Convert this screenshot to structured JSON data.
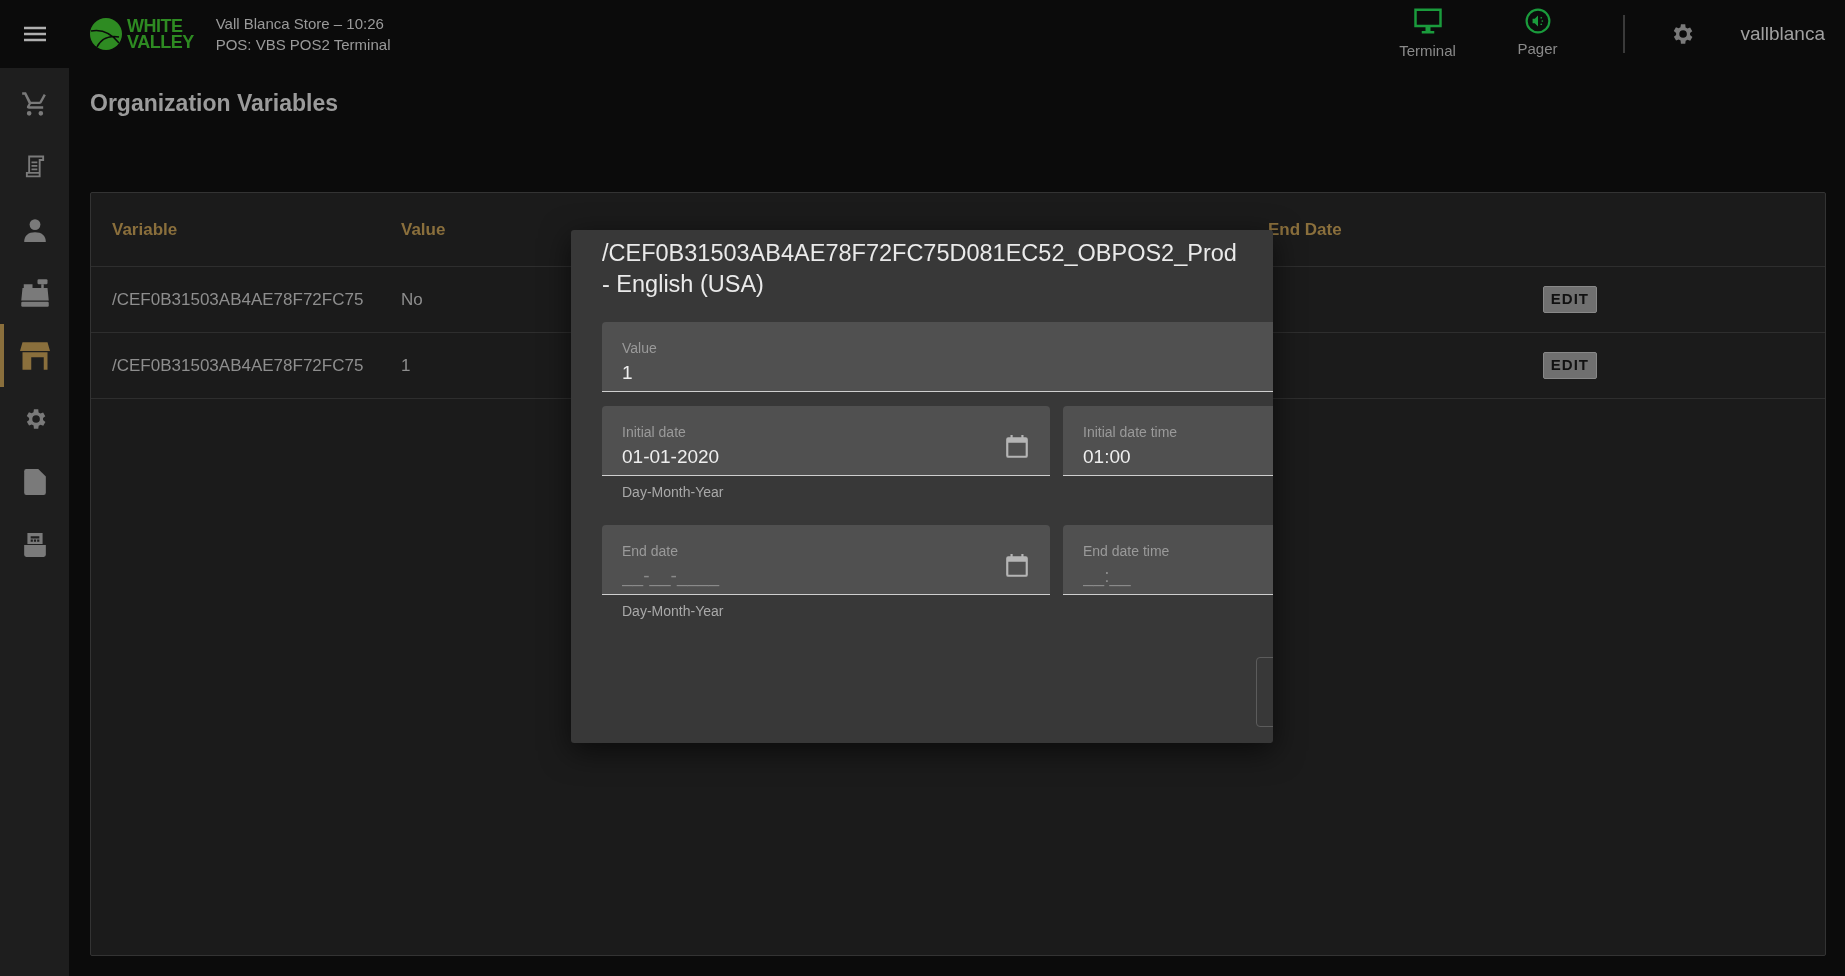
{
  "header": {
    "logo_lines": [
      "WHITE",
      "VALLEY"
    ],
    "store_line": "Vall Blanca Store – 10:26",
    "pos_line": "POS: VBS POS2 Terminal",
    "actions": [
      {
        "kind": "terminal",
        "label": "Terminal"
      },
      {
        "kind": "pager",
        "label": "Pager"
      }
    ],
    "user": "vallblanca"
  },
  "sidebar": {
    "items": [
      {
        "kind": "cart",
        "selected": false
      },
      {
        "kind": "receipt",
        "selected": false
      },
      {
        "kind": "person",
        "selected": false
      },
      {
        "kind": "register",
        "selected": false
      },
      {
        "kind": "store",
        "selected": true
      },
      {
        "kind": "gear",
        "selected": false
      },
      {
        "kind": "document",
        "selected": false
      },
      {
        "kind": "printer",
        "selected": false
      }
    ]
  },
  "page_title": "Organization Variables",
  "table": {
    "columns": [
      "Variable",
      "Value",
      "End Date"
    ],
    "rows": [
      {
        "variable": "/CEF0B31503AB4AE78F72FC75",
        "value": "No",
        "action": "EDIT"
      },
      {
        "variable": "/CEF0B31503AB4AE78F72FC75",
        "value": "1",
        "action": "EDIT"
      }
    ]
  },
  "dialog": {
    "title_lines": [
      "/CEF0B31503AB4AE78F72FC75D081EC52_OBPOS2_Prod",
      "- English (USA)"
    ],
    "fields": [
      {
        "kind": "text",
        "label": "Value",
        "value": "1"
      },
      {
        "kind": "date",
        "label": "Initial date",
        "value": "01-01-2020",
        "helper": "Day-Month-Year"
      },
      {
        "kind": "time",
        "label": "Initial date time",
        "value": "01:00"
      },
      {
        "kind": "date",
        "label": "End date",
        "placeholder": "__-__-____",
        "helper": "Day-Month-Year"
      },
      {
        "kind": "time",
        "label": "End date time",
        "placeholder": "__:__"
      }
    ]
  }
}
